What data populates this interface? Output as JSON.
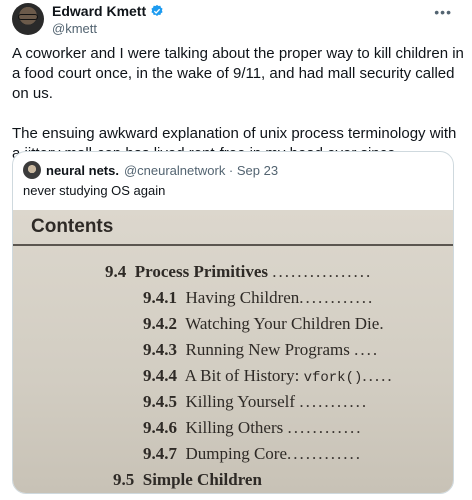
{
  "author": {
    "name": "Edward Kmett",
    "handle": "@kmett"
  },
  "tweet": {
    "paragraphs": [
      "A coworker and I were talking about the proper way to kill children in a food court once, in the wake of 9/11, and had mall security called on us.",
      "The ensuing awkward explanation of unix process terminology with a jittery mall-cop has lived rent-free in my head ever since."
    ]
  },
  "quote": {
    "name": "neural nets.",
    "meta": "@cneuralnetwork · Sep 23",
    "text": "never studying OS again",
    "image": {
      "heading": "Contents",
      "toc": [
        {
          "num": "9.4",
          "title": "Process Primitives",
          "dots": "................"
        },
        {
          "num": "9.4.1",
          "title": "Having Children",
          "dots": "............"
        },
        {
          "num": "9.4.2",
          "title": "Watching Your Children Die",
          "dots": "."
        },
        {
          "num": "9.4.3",
          "title": "Running New Programs",
          "dots": "...."
        },
        {
          "num": "9.4.4",
          "title": "A Bit of History:",
          "code": "vfork()",
          "dots": "....."
        },
        {
          "num": "9.4.5",
          "title": "Killing Yourself",
          "dots": "..........."
        },
        {
          "num": "9.4.6",
          "title": "Killing Others",
          "dots": "............"
        },
        {
          "num": "9.4.7",
          "title": "Dumping Core",
          "dots": "............"
        },
        {
          "num": "9.5",
          "title": "Simple Children",
          "dots": ""
        }
      ]
    }
  },
  "colors": {
    "verified": "#1d9bf0",
    "text": "#0f1419",
    "secondary": "#536471",
    "border": "#cfd9de"
  },
  "icons": {
    "verified": "verified-badge-icon",
    "more": "more-dots-icon"
  }
}
